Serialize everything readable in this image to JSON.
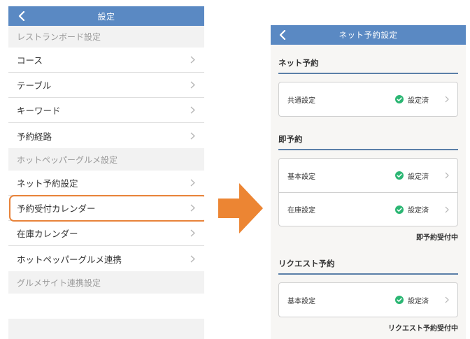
{
  "left_screen": {
    "header": {
      "title": "設定",
      "back_icon": "chevron-left-icon"
    },
    "sections": [
      {
        "title": "レストランボード設定",
        "items": [
          {
            "label": "コース"
          },
          {
            "label": "テーブル"
          },
          {
            "label": "キーワード"
          },
          {
            "label": "予約経路"
          }
        ]
      },
      {
        "title": "ホットペッパーグルメ設定",
        "items": [
          {
            "label": "ネット予約設定",
            "highlighted": true
          },
          {
            "label": "予約受付カレンダー"
          },
          {
            "label": "在庫カレンダー"
          },
          {
            "label": "ホットペッパーグルメ連携"
          }
        ]
      },
      {
        "title": "グルメサイト連携設定",
        "items": []
      }
    ],
    "highlight_color": "#e8833a"
  },
  "arrow": {
    "color": "#ec8533",
    "icon": "arrow-right-icon"
  },
  "right_screen": {
    "header": {
      "title": "ネット予約設定",
      "back_icon": "chevron-left-icon"
    },
    "sections": [
      {
        "title": "ネット予約",
        "rows": [
          {
            "label": "共通設定",
            "status": "設定済"
          }
        ],
        "note": ""
      },
      {
        "title": "即予約",
        "rows": [
          {
            "label": "基本設定",
            "status": "設定済"
          },
          {
            "label": "在庫設定",
            "status": "設定済"
          }
        ],
        "note": "即予約受付中"
      },
      {
        "title": "リクエスト予約",
        "rows": [
          {
            "label": "基本設定",
            "status": "設定済"
          }
        ],
        "note": "リクエスト予約受付中"
      }
    ],
    "check_color": "#2bb673",
    "accent_color": "#5a89c3"
  }
}
